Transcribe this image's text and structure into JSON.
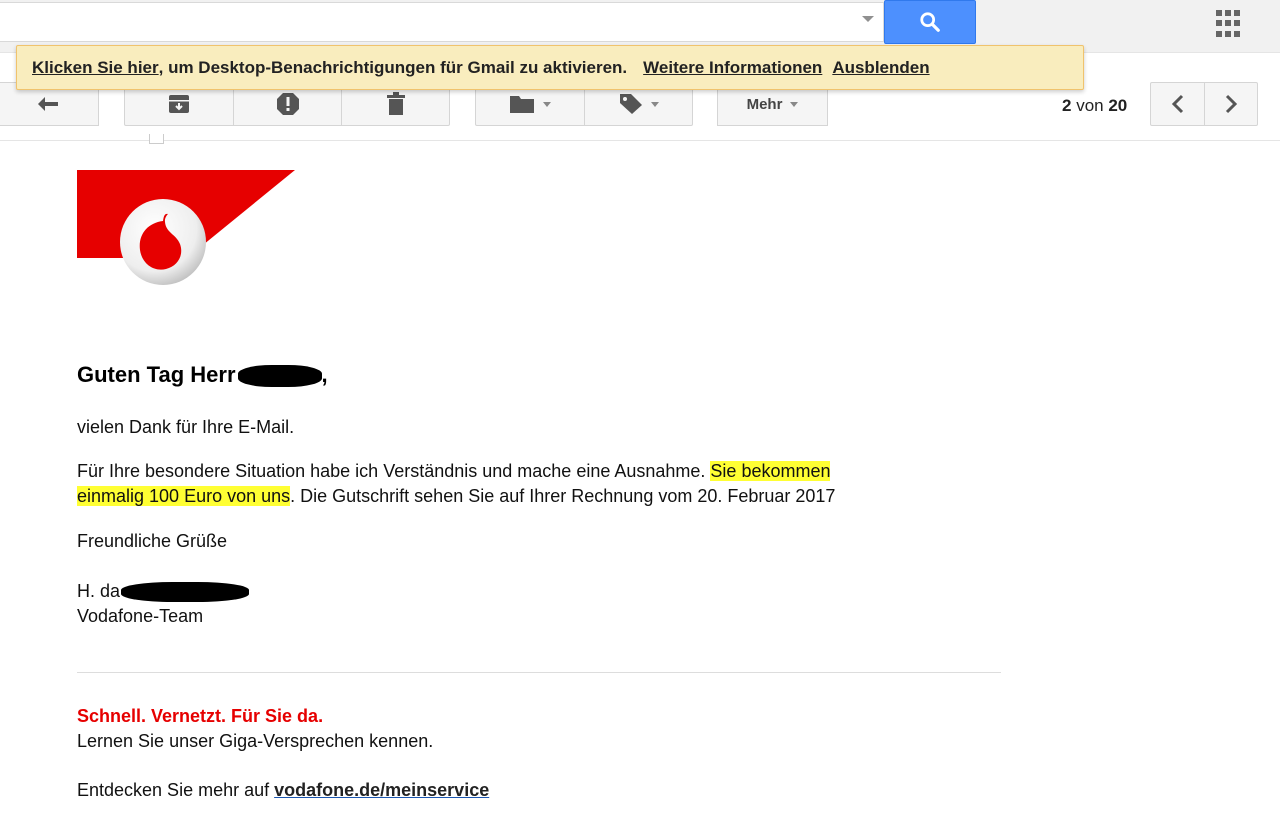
{
  "search": {
    "value": "",
    "placeholder": ""
  },
  "notification": {
    "link_text": "Klicken Sie hier",
    "message": ", um Desktop-Benachrichtigungen für Gmail zu aktivieren.",
    "more_info": "Weitere Informationen",
    "dismiss": "Ausblenden"
  },
  "toolbar": {
    "more_label": "Mehr",
    "pager_current": "2",
    "pager_of": " von ",
    "pager_total": "20"
  },
  "email": {
    "greeting": "Guten Tag Herr",
    "greeting_end": ",",
    "line1": "vielen Dank für Ihre E-Mail.",
    "p2_a": "Für Ihre besondere Situation habe ich Verständnis und mache eine Ausnahme. ",
    "p2_hl1": "Sie bekommen",
    "p2_hl2": "einmalig 100 Euro von uns",
    "p2_b": ". Die Gutschrift sehen Sie auf Ihrer Rechnung vom 20. Februar 2017",
    "closing": "Freundliche Grüße",
    "signature_prefix": "H. da",
    "team": "Vodafone-Team",
    "slogan": "Schnell. Vernetzt. Für Sie da.",
    "slogan_sub": "Lernen Sie unser Giga-Versprechen kennen.",
    "discover": "Entdecken Sie mehr auf ",
    "discover_link": "vodafone.de/meinservice"
  },
  "colors": {
    "search_blue": "#4d90fe",
    "notify_bg": "#f9edbe",
    "vodafone_red": "#e60000",
    "highlight": "#ffff33"
  },
  "icons": [
    "search-icon",
    "apps-grid-icon",
    "reply-icon",
    "archive-icon",
    "spam-icon",
    "delete-icon",
    "folder-icon",
    "label-icon",
    "chevron-left-icon",
    "chevron-right-icon",
    "vodafone-logo-icon"
  ]
}
